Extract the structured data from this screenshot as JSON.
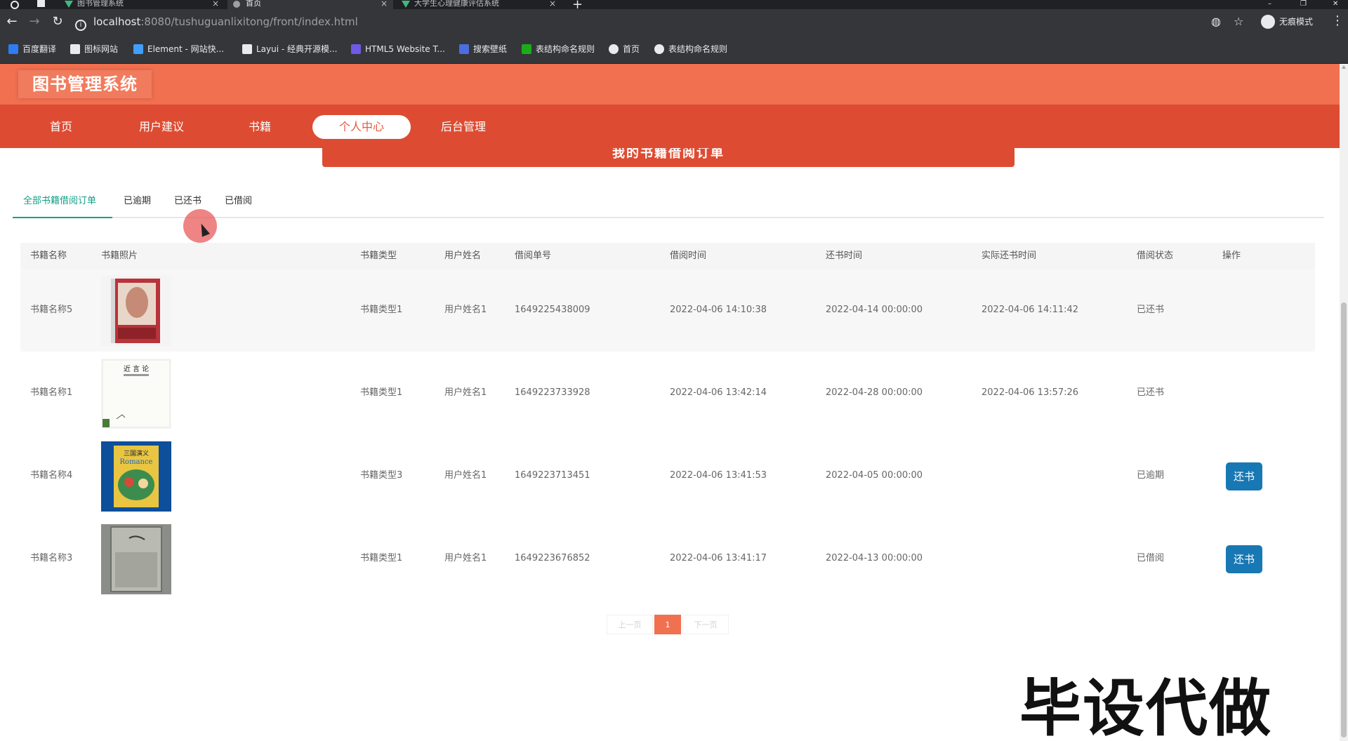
{
  "browser": {
    "tabs": [
      {
        "title": "图书管理系统",
        "active": false
      },
      {
        "title": "首页",
        "active": true
      },
      {
        "title": "大学生心理健康评估系统",
        "active": false
      }
    ],
    "new_tab_label": "+",
    "url_host": "localhost",
    "url_path": ":8080/tushuguanlixitong/front/index.html",
    "incognito_label": "无痕模式",
    "bookmarks": [
      {
        "label": "百度翻译",
        "color": "#2d7cf4"
      },
      {
        "label": "图标网站",
        "color": "#e8eaed"
      },
      {
        "label": "Element - 网站快...",
        "color": "#409eff"
      },
      {
        "label": "Layui - 经典开源模...",
        "color": "#e8eaed"
      },
      {
        "label": "HTML5 Website T...",
        "color": "#6f59e6"
      },
      {
        "label": "搜索壁纸",
        "color": "#4a6ee0"
      },
      {
        "label": "表结构命名规则",
        "color": "#1aad19"
      },
      {
        "label": "首页",
        "color": "#e8eaed"
      },
      {
        "label": "表结构命名规则",
        "color": "#e8eaed"
      }
    ]
  },
  "site": {
    "title": "图书管理系统",
    "accent": "#f07050",
    "nav_color": "#dd4c32",
    "nav": [
      "首页",
      "用户建议",
      "书籍",
      "个人中心",
      "后台管理"
    ],
    "active_nav": "个人中心",
    "banner_text": "我的书籍借阅订单"
  },
  "order_tabs": [
    "全部书籍借阅订单",
    "已逾期",
    "已还书",
    "已借阅"
  ],
  "active_order_tab": "全部书籍借阅订单",
  "table": {
    "headers": [
      "书籍名称",
      "书籍照片",
      "书籍类型",
      "用户姓名",
      "借阅单号",
      "借阅时间",
      "还书时间",
      "实际还书时间",
      "借阅状态",
      "操作"
    ],
    "rows": [
      {
        "name": "书籍名称5",
        "cover": "cover-red-book",
        "type": "书籍类型1",
        "user": "用户姓名1",
        "order_no": "1649225438009",
        "borrow_time": "2022-04-06 14:10:38",
        "due_time": "2022-04-14 00:00:00",
        "actual_return": "2022-04-06 14:11:42",
        "status": "已还书",
        "action": ""
      },
      {
        "name": "书籍名称1",
        "cover": "cover-white-book",
        "type": "书籍类型1",
        "user": "用户姓名1",
        "order_no": "1649223733928",
        "borrow_time": "2022-04-06 13:42:14",
        "due_time": "2022-04-28 00:00:00",
        "actual_return": "2022-04-06 13:57:26",
        "status": "已还书",
        "action": ""
      },
      {
        "name": "书籍名称4",
        "cover": "cover-romance-book",
        "type": "书籍类型3",
        "user": "用户姓名1",
        "order_no": "1649223713451",
        "borrow_time": "2022-04-06 13:41:53",
        "due_time": "2022-04-05 00:00:00",
        "actual_return": "",
        "status": "已逾期",
        "action": "还书"
      },
      {
        "name": "书籍名称3",
        "cover": "cover-gray-book",
        "type": "书籍类型1",
        "user": "用户姓名1",
        "order_no": "1649223676852",
        "borrow_time": "2022-04-06 13:41:17",
        "due_time": "2022-04-13 00:00:00",
        "actual_return": "",
        "status": "已借阅",
        "action": "还书"
      }
    ]
  },
  "pagination": {
    "prev": "上一页",
    "current": "1",
    "next": "下一页"
  },
  "watermark": "毕设代做",
  "cover_texts": {
    "white_book": "近 言 论",
    "romance_title": "三国演义",
    "romance_sub": "Romance"
  },
  "colors": {
    "tab_active": "#13a087",
    "return_button": "#1778b4"
  }
}
